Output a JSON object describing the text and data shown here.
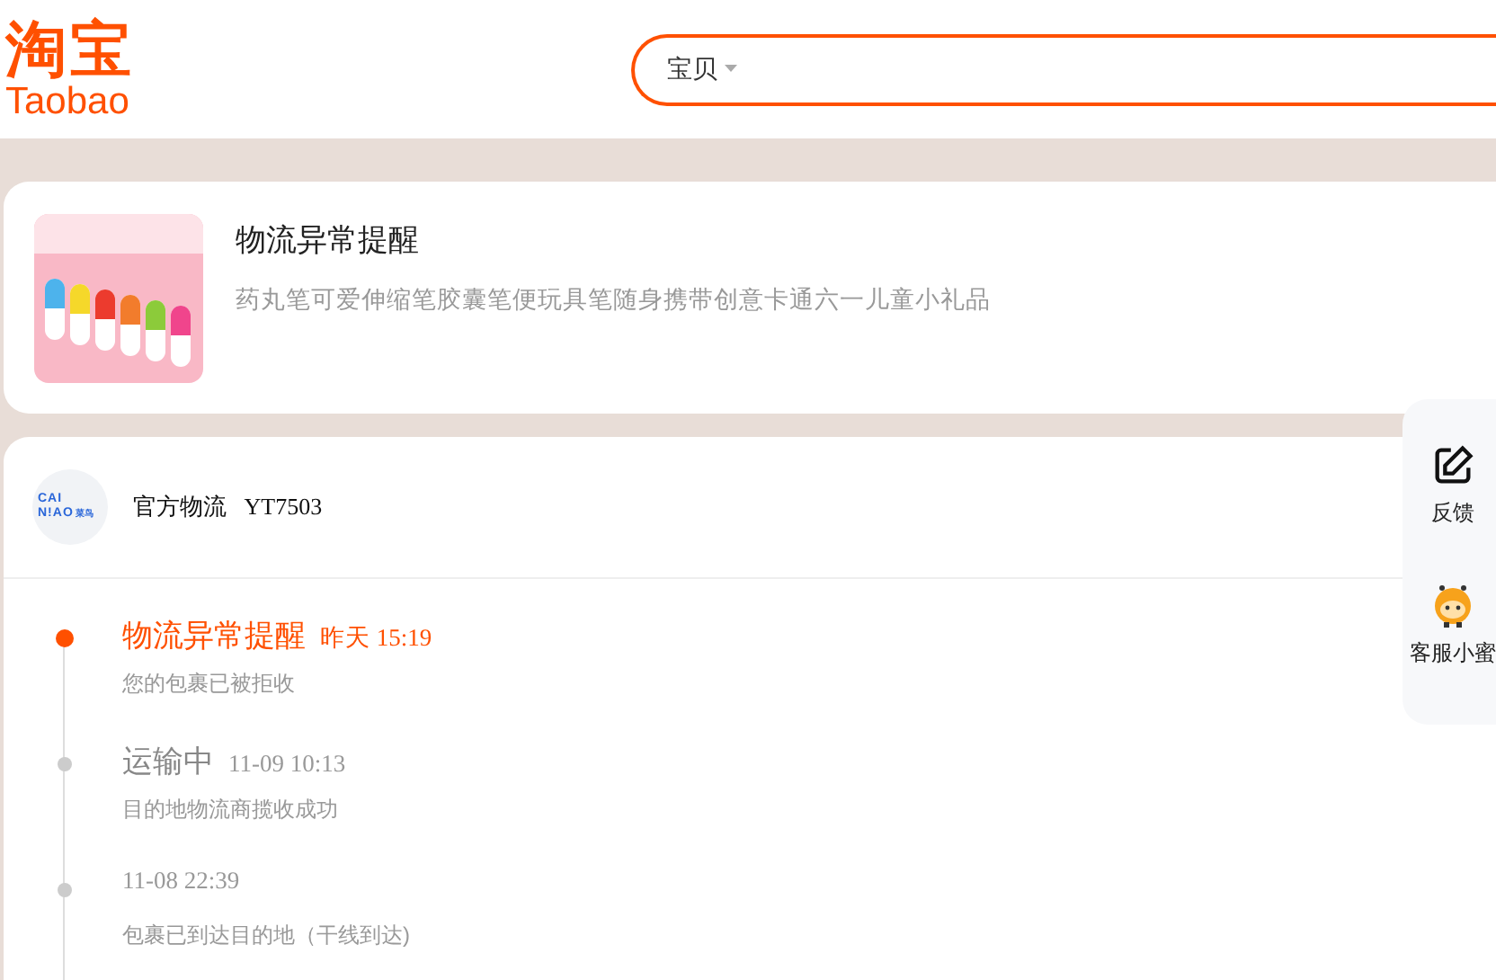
{
  "logo": {
    "cn": "淘宝",
    "en": "Taobao"
  },
  "search": {
    "scope": "宝贝"
  },
  "alert_card": {
    "title": "物流异常提醒",
    "product": "药丸笔可爱伸缩笔胶囊笔便玩具笔随身携带创意卡通六一儿童小礼品"
  },
  "carrier": {
    "logo": {
      "line1": "CAI",
      "line2": "N!AO",
      "mark": "菜鸟"
    },
    "name": "官方物流",
    "tracking": "YT7503"
  },
  "events": [
    {
      "title": "物流异常提醒",
      "time": "昨天 15:19",
      "desc": "您的包裹已被拒收",
      "current": true
    },
    {
      "title": "运输中",
      "time": "11-09 10:13",
      "desc": "目的地物流商揽收成功",
      "current": false
    },
    {
      "time": "11-08 22:39",
      "desc": "包裹已到达目的地（干线到达)",
      "current": false
    }
  ],
  "side_panel": [
    {
      "kind": "feedback",
      "label": "反馈"
    },
    {
      "kind": "service",
      "label": "客服小蜜"
    }
  ]
}
